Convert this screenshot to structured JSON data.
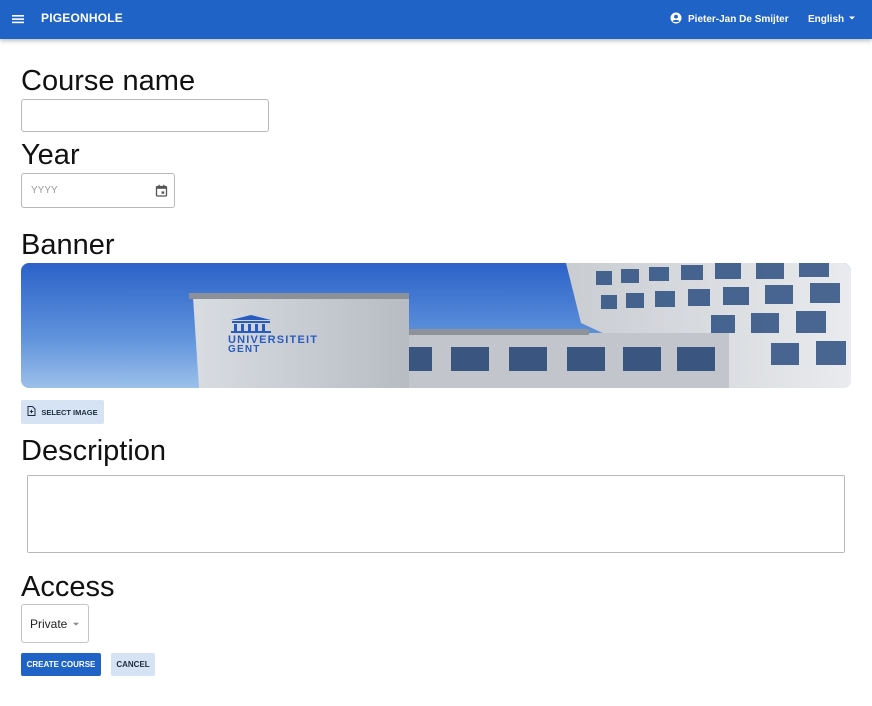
{
  "appbar": {
    "title": "PIGEONHOLE",
    "user_name": "Pieter-Jan De Smijter",
    "language": "English",
    "menu_icon": "hamburger-menu-icon",
    "user_icon": "account-circle-icon",
    "lang_icon": "caret-down-icon",
    "bar_color": "#1f63c6"
  },
  "form": {
    "course_name_label": "Course name",
    "course_name_value": "",
    "year_label": "Year",
    "year_placeholder": "YYYY",
    "banner_label": "Banner",
    "banner_image_text": "UNIVERSITEIT GENT",
    "select_image_label": "SELECT IMAGE",
    "description_label": "Description",
    "description_value": "",
    "access_label": "Access",
    "access_selected": "Private",
    "create_label": "CREATE COURSE",
    "cancel_label": "CANCEL"
  }
}
